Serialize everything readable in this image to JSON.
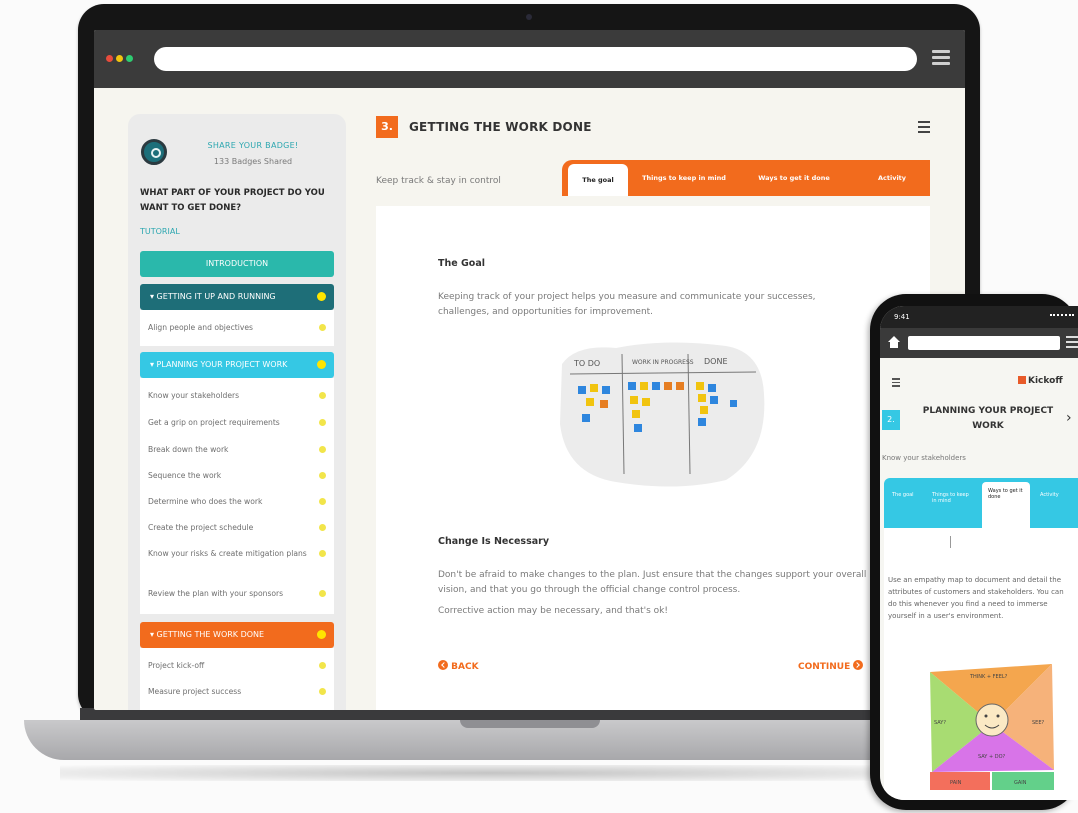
{
  "sidebar": {
    "share_title": "SHARE YOUR BADGE!",
    "share_count": "133 Badges Shared",
    "question": "WHAT PART OF YOUR PROJECT DO YOU WANT TO GET DONE?",
    "tutorial": "TUTORIAL",
    "sections": [
      {
        "label": "INTRODUCTION"
      },
      {
        "label": "▾  GETTING IT UP AND RUNNING"
      },
      {
        "label": "▾  PLANNING YOUR PROJECT WORK"
      },
      {
        "label": "▾  GETTING THE WORK DONE"
      }
    ],
    "getting_items": [
      "Align people and objectives"
    ],
    "planning_items": [
      "Know your stakeholders",
      "Get a grip on project requirements",
      "Break down the work",
      "Sequence the work",
      "Determine who does the work",
      "Create the project schedule",
      "Know your risks & create mitigation plans",
      "Review the plan with your sponsors"
    ],
    "workdone_items": [
      "Project kick-off",
      "Measure project success"
    ]
  },
  "main": {
    "step_number": "3.",
    "step_title": "GETTING THE WORK DONE",
    "subtitle": "Keep track & stay in control",
    "tabs": [
      "The goal",
      "Things to keep in mind",
      "Ways to get it done",
      "Activity"
    ],
    "active_tab": "The goal",
    "goal_heading": "The Goal",
    "goal_text": "Keeping track of your project helps you measure and communicate your successes, challenges, and opportunities for improvement.",
    "kanban_labels": [
      "TO DO",
      "WORK IN PROGRESS",
      "DONE"
    ],
    "change_heading": "Change Is Necessary",
    "change_text": "Don't be afraid to make changes to the plan. Just ensure that the changes support your overall vision, and that you go through the official change control process.",
    "corrective_text": "Corrective action may be necessary, and that's ok!",
    "back_label": "BACK",
    "continue_label": "CONTINUE"
  },
  "phone": {
    "time": "9:41",
    "brand": "Kickoff",
    "step_number": "2.",
    "title": "PLANNING YOUR PROJECT WORK",
    "stakeholders": "Know your stakeholders",
    "tabs": [
      "The goal",
      "Things to keep in mind",
      "Ways to get it done",
      "Activity"
    ],
    "active_tab": "Ways to get it done",
    "body_text": "Use an empathy map to document and detail the attributes of customers and stakeholders. You can do this whenever you find a need to immerse yourself in a user's environment.",
    "map_labels": [
      "THINK + FEEL?",
      "SAY?",
      "SEE?",
      "SAY + DO?",
      "PAIN",
      "GAIN"
    ]
  },
  "colors": {
    "accent_orange": "#f26b1d",
    "teal": "#2ab8ab",
    "dark_teal": "#1e6e78",
    "cyan": "#35c8e4"
  }
}
